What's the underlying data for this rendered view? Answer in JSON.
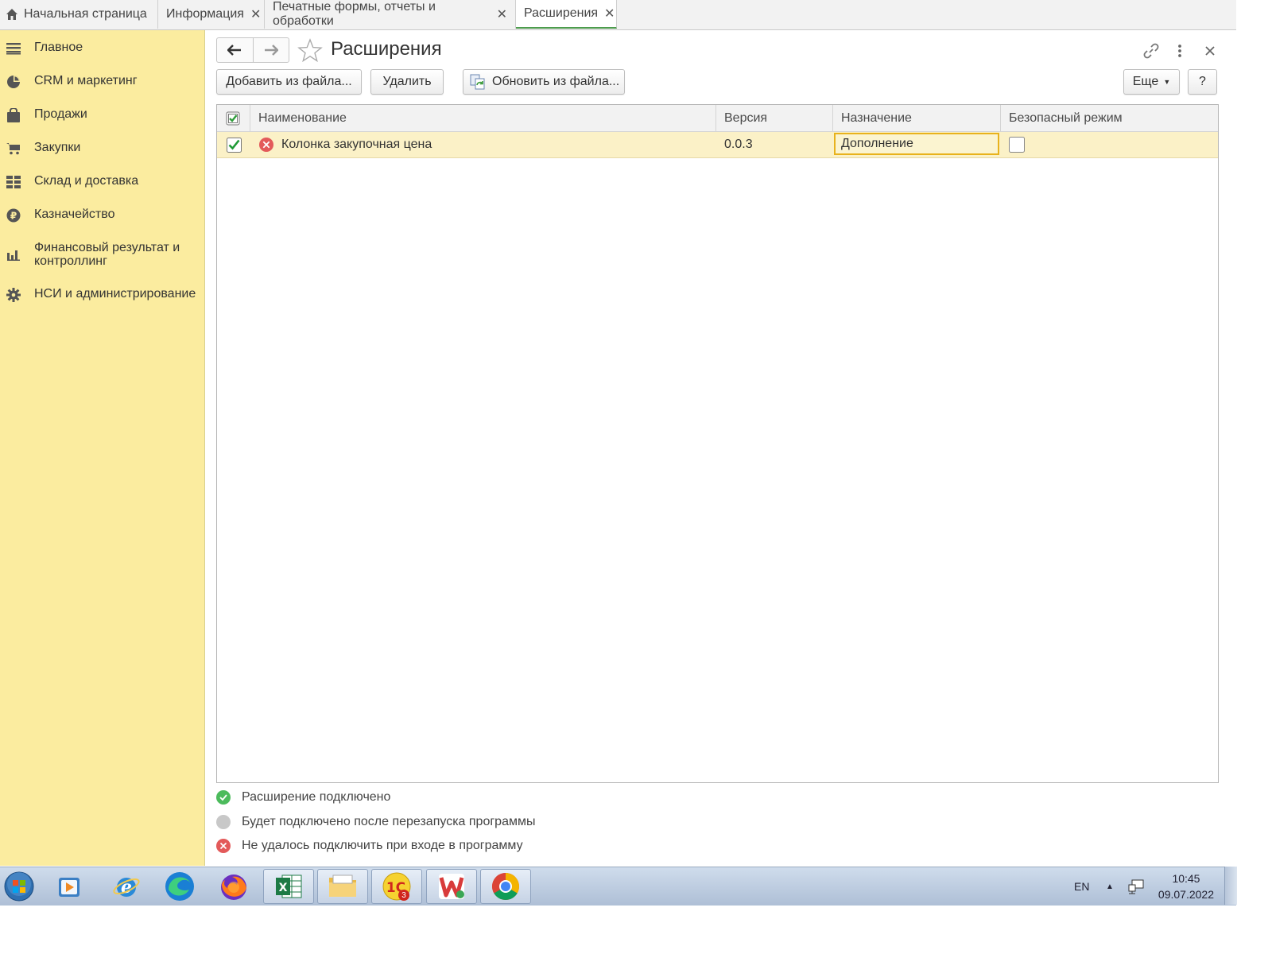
{
  "tabs": [
    {
      "label": "Начальная страница",
      "closable": false
    },
    {
      "label": "Информация",
      "closable": true
    },
    {
      "label": "Печатные формы, отчеты и обработки",
      "closable": true
    },
    {
      "label": "Расширения",
      "closable": true,
      "active": true
    }
  ],
  "sidebar": {
    "items": [
      {
        "label": "Главное",
        "icon": "menu-lines-icon"
      },
      {
        "label": "CRM и маркетинг",
        "icon": "pie-chart-icon"
      },
      {
        "label": "Продажи",
        "icon": "shopping-bag-icon"
      },
      {
        "label": "Закупки",
        "icon": "cart-icon"
      },
      {
        "label": "Склад и доставка",
        "icon": "warehouse-grid-icon"
      },
      {
        "label": "Казначейство",
        "icon": "ruble-coin-icon"
      },
      {
        "label": "Финансовый результат и\nконтроллинг",
        "icon": "bar-chart-icon"
      },
      {
        "label": "НСИ и администрирование",
        "icon": "gear-icon"
      }
    ]
  },
  "page": {
    "title": "Расширения"
  },
  "toolbar": {
    "add_label": "Добавить из файла...",
    "delete_label": "Удалить",
    "update_label": "Обновить из файла...",
    "more_label": "Еще",
    "help_label": "?"
  },
  "table": {
    "columns": [
      "Наименование",
      "Версия",
      "Назначение",
      "Безопасный режим"
    ],
    "rows": [
      {
        "active": true,
        "status": "error",
        "name": "Колонка закупочная цена",
        "version": "0.0.3",
        "purpose": "Дополнение",
        "safe_mode": false
      }
    ]
  },
  "legend": [
    {
      "status": "connected",
      "color": "#4cbb5c",
      "text": "Расширение подключено"
    },
    {
      "status": "pending",
      "color": "#c8c8c8",
      "text": "Будет подключено после перезапуска программы"
    },
    {
      "status": "failed",
      "color": "#e35a5a",
      "text": "Не удалось подключить при входе в программу"
    }
  ],
  "taskbar": {
    "apps": [
      "start-orb-icon",
      "media-player-icon",
      "internet-explorer-icon",
      "edge-icon",
      "firefox-icon",
      "excel-icon",
      "file-explorer-icon",
      "1c-icon",
      "wps-icon",
      "chrome-icon"
    ],
    "onec_badge": "3",
    "lang": "EN",
    "time": "10:45",
    "date": "09.07.2022"
  },
  "colors": {
    "sidebar_bg": "#fbec9f",
    "row_highlight": "#fbf1c7",
    "focus_border": "#e8b21c",
    "active_tab_underline": "#4d9c4d"
  }
}
